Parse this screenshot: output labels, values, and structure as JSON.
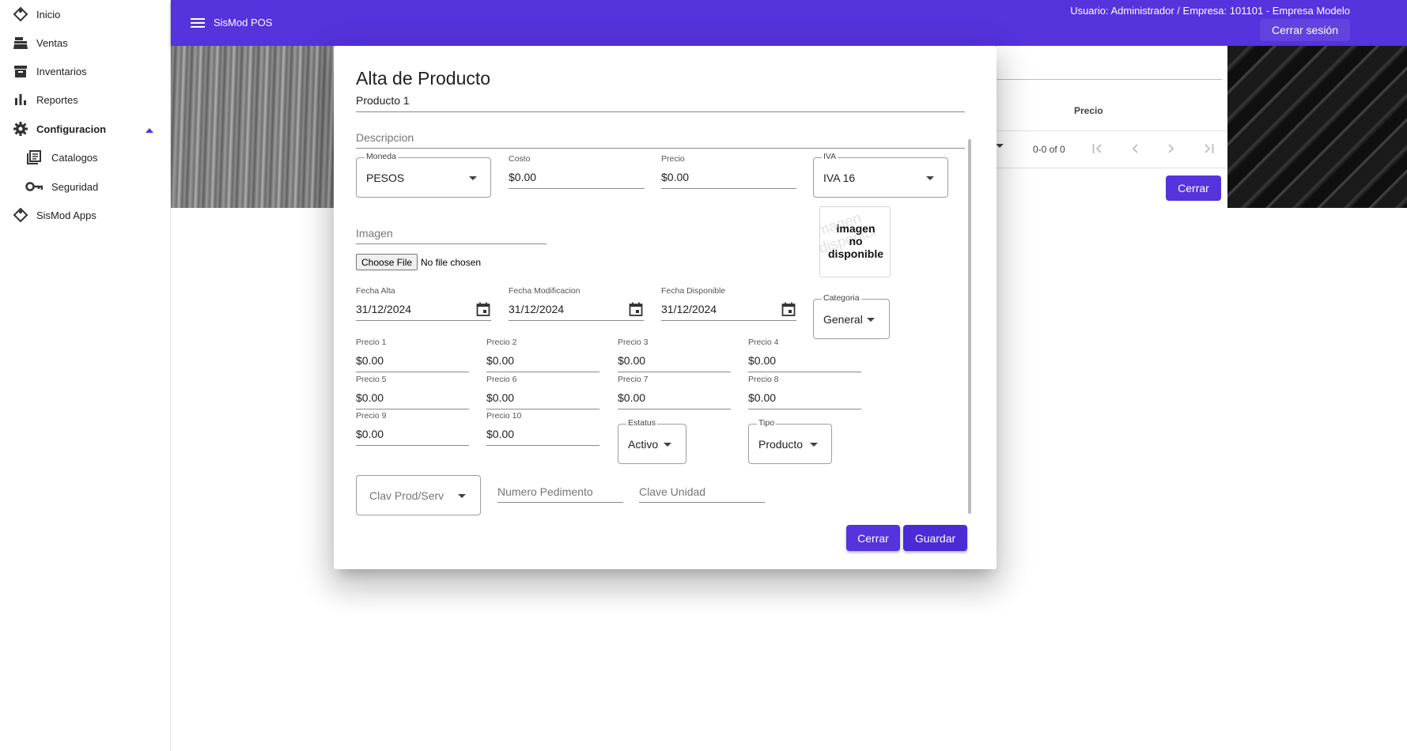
{
  "sidebar": {
    "items": [
      {
        "label": "Inicio",
        "icon": "home-icon"
      },
      {
        "label": "Ventas",
        "icon": "register-icon"
      },
      {
        "label": "Inventarios",
        "icon": "archive-icon"
      },
      {
        "label": "Reportes",
        "icon": "bar-chart-icon"
      },
      {
        "label": "Configuracion",
        "icon": "gear-icon",
        "expanded": true
      },
      {
        "label": "Catalogos",
        "icon": "library-icon"
      },
      {
        "label": "Seguridad",
        "icon": "key-icon"
      },
      {
        "label": "SisMod Apps",
        "icon": "home-icon"
      }
    ]
  },
  "header": {
    "title": "SisMod POS",
    "user_info": "Usuario: Administrador / Empresa: 101101 - Empresa Modelo",
    "logout_label": "Cerrar sesión"
  },
  "background": {
    "price_header": "Precio",
    "page_info": "0-0 of 0",
    "close_label": "Cerrar"
  },
  "dialog": {
    "title": "Alta de Producto",
    "product_name": "Producto 1",
    "description_placeholder": "Descripcion",
    "moneda": {
      "label": "Moneda",
      "value": "PESOS"
    },
    "costo": {
      "label": "Costo",
      "value": "$0.00"
    },
    "precio": {
      "label": "Precio",
      "value": "$0.00"
    },
    "iva": {
      "label": "IVA",
      "value": "IVA 16"
    },
    "imagen_placeholder": "Imagen",
    "file_button": "Choose File",
    "file_status": "No file chosen",
    "image_placeholder_text": "imagen\nno\ndisponible",
    "fecha_alta": {
      "label": "Fecha Alta",
      "value": "31/12/2024"
    },
    "fecha_modificacion": {
      "label": "Fecha Modificacion",
      "value": "31/12/2024"
    },
    "fecha_disponible": {
      "label": "Fecha Disponible",
      "value": "31/12/2024"
    },
    "categoria": {
      "label": "Categoria",
      "value": "General"
    },
    "precios": [
      {
        "label": "Precio 1",
        "value": "$0.00"
      },
      {
        "label": "Precio 2",
        "value": "$0.00"
      },
      {
        "label": "Precio 3",
        "value": "$0.00"
      },
      {
        "label": "Precio 4",
        "value": "$0.00"
      },
      {
        "label": "Precio 5",
        "value": "$0.00"
      },
      {
        "label": "Precio 6",
        "value": "$0.00"
      },
      {
        "label": "Precio 7",
        "value": "$0.00"
      },
      {
        "label": "Precio 8",
        "value": "$0.00"
      },
      {
        "label": "Precio 9",
        "value": "$0.00"
      },
      {
        "label": "Precio 10",
        "value": "$0.00"
      }
    ],
    "estatus": {
      "label": "Estatus",
      "value": "Activo"
    },
    "tipo": {
      "label": "Tipo",
      "value": "Producto"
    },
    "clav_prod_serv_placeholder": "Clav Prod/Serv",
    "numero_pedimento_placeholder": "Numero Pedimento",
    "clave_unidad_placeholder": "Clave Unidad",
    "close_label": "Cerrar",
    "save_label": "Guardar"
  },
  "colors": {
    "accent": "#5533dd"
  }
}
